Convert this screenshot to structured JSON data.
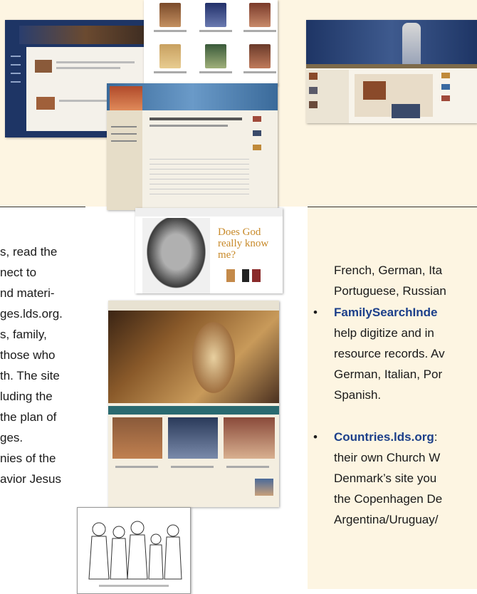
{
  "left_column": {
    "lines": [
      "s, read the",
      "nect to",
      "nd materi-",
      "ges.lds.org.",
      "s, family,",
      "those who",
      "th. The site",
      "luding the",
      "the plan of",
      "ges.",
      "nies of the",
      "avior Jesus"
    ]
  },
  "right_column": {
    "lines_a": [
      "French, German, Ita",
      "Portuguese, Russian"
    ],
    "item1_title": "FamilySearchInde",
    "item1_lines": [
      "help digitize and in",
      "resource records. Av",
      "German, Italian, Por",
      "Spanish."
    ],
    "item2_title": "Countries.lds.org",
    "item2_colon": ":",
    "item2_lines": [
      "their own Church W",
      "Denmark’s site you",
      "the Copenhagen De",
      "Argentina/Uruguay/"
    ]
  },
  "bullet_char": "•",
  "screens": {
    "featured_text": "Does God really know me?"
  },
  "colors": {
    "cream": "#fdf5e2",
    "link_blue": "#1c3f8a",
    "site_navy": "#1e3565"
  }
}
